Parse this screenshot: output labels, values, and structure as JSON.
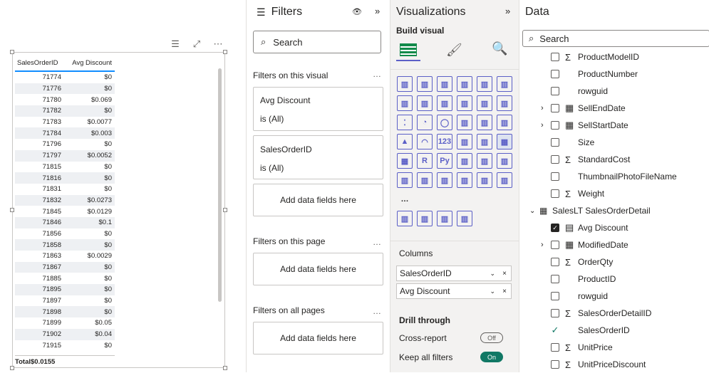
{
  "table": {
    "col1": "SalesOrderID",
    "col2": "Avg Discount",
    "rows": [
      [
        "71774",
        "$0"
      ],
      [
        "71776",
        "$0"
      ],
      [
        "71780",
        "$0.069"
      ],
      [
        "71782",
        "$0"
      ],
      [
        "71783",
        "$0.0077"
      ],
      [
        "71784",
        "$0.003"
      ],
      [
        "71796",
        "$0"
      ],
      [
        "71797",
        "$0.0052"
      ],
      [
        "71815",
        "$0"
      ],
      [
        "71816",
        "$0"
      ],
      [
        "71831",
        "$0"
      ],
      [
        "71832",
        "$0.0273"
      ],
      [
        "71845",
        "$0.0129"
      ],
      [
        "71846",
        "$0.1"
      ],
      [
        "71856",
        "$0"
      ],
      [
        "71858",
        "$0"
      ],
      [
        "71863",
        "$0.0029"
      ],
      [
        "71867",
        "$0"
      ],
      [
        "71885",
        "$0"
      ],
      [
        "71895",
        "$0"
      ],
      [
        "71897",
        "$0"
      ],
      [
        "71898",
        "$0"
      ],
      [
        "71899",
        "$0.05"
      ],
      [
        "71902",
        "$0.04"
      ],
      [
        "71915",
        "$0"
      ]
    ],
    "total_label": "Total",
    "total_value": "$0.0155"
  },
  "filters": {
    "title": "Filters",
    "search_placeholder": "Search",
    "on_visual": "Filters on this visual",
    "card1_title": "Avg Discount",
    "card1_sub": "is (All)",
    "card2_title": "SalesOrderID",
    "card2_sub": "is (All)",
    "add_fields": "Add data fields here",
    "on_page": "Filters on this page",
    "on_all": "Filters on all pages"
  },
  "viz": {
    "title": "Visualizations",
    "build": "Build visual",
    "columns": "Columns",
    "col_field1": "SalesOrderID",
    "col_field2": "Avg Discount",
    "drill": "Drill through",
    "cross": "Cross-report",
    "cross_state": "Off",
    "keep": "Keep all filters",
    "keep_state": "On",
    "more": "..."
  },
  "data": {
    "title": "Data",
    "search_placeholder": "Search",
    "items": [
      {
        "label": "ProductModelID",
        "sigma": true,
        "checked": false,
        "expand": false
      },
      {
        "label": "ProductNumber",
        "sigma": false,
        "checked": false,
        "expand": false
      },
      {
        "label": "rowguid",
        "sigma": false,
        "checked": false,
        "expand": false
      },
      {
        "label": "SellEndDate",
        "sigma": false,
        "checked": false,
        "expand": true,
        "cal": true
      },
      {
        "label": "SellStartDate",
        "sigma": false,
        "checked": false,
        "expand": true,
        "cal": true
      },
      {
        "label": "Size",
        "sigma": false,
        "checked": false,
        "expand": false
      },
      {
        "label": "StandardCost",
        "sigma": true,
        "checked": false,
        "expand": false
      },
      {
        "label": "ThumbnailPhotoFileName",
        "sigma": false,
        "checked": false,
        "expand": false
      },
      {
        "label": "Weight",
        "sigma": true,
        "checked": false,
        "expand": false
      }
    ],
    "table_name": "SalesLT SalesOrderDetail",
    "items2": [
      {
        "label": "Avg Discount",
        "checked": true,
        "calc": true
      },
      {
        "label": "ModifiedDate",
        "checked": false,
        "expand": true,
        "cal": true
      },
      {
        "label": "OrderQty",
        "checked": false,
        "sigma": true
      },
      {
        "label": "ProductID",
        "checked": false
      },
      {
        "label": "rowguid",
        "checked": false
      },
      {
        "label": "SalesOrderDetailID",
        "checked": false,
        "sigma": true
      },
      {
        "label": "SalesOrderID",
        "checked": true,
        "plain": true
      },
      {
        "label": "UnitPrice",
        "checked": false,
        "sigma": true
      },
      {
        "label": "UnitPriceDiscount",
        "checked": false,
        "sigma": true
      }
    ]
  }
}
